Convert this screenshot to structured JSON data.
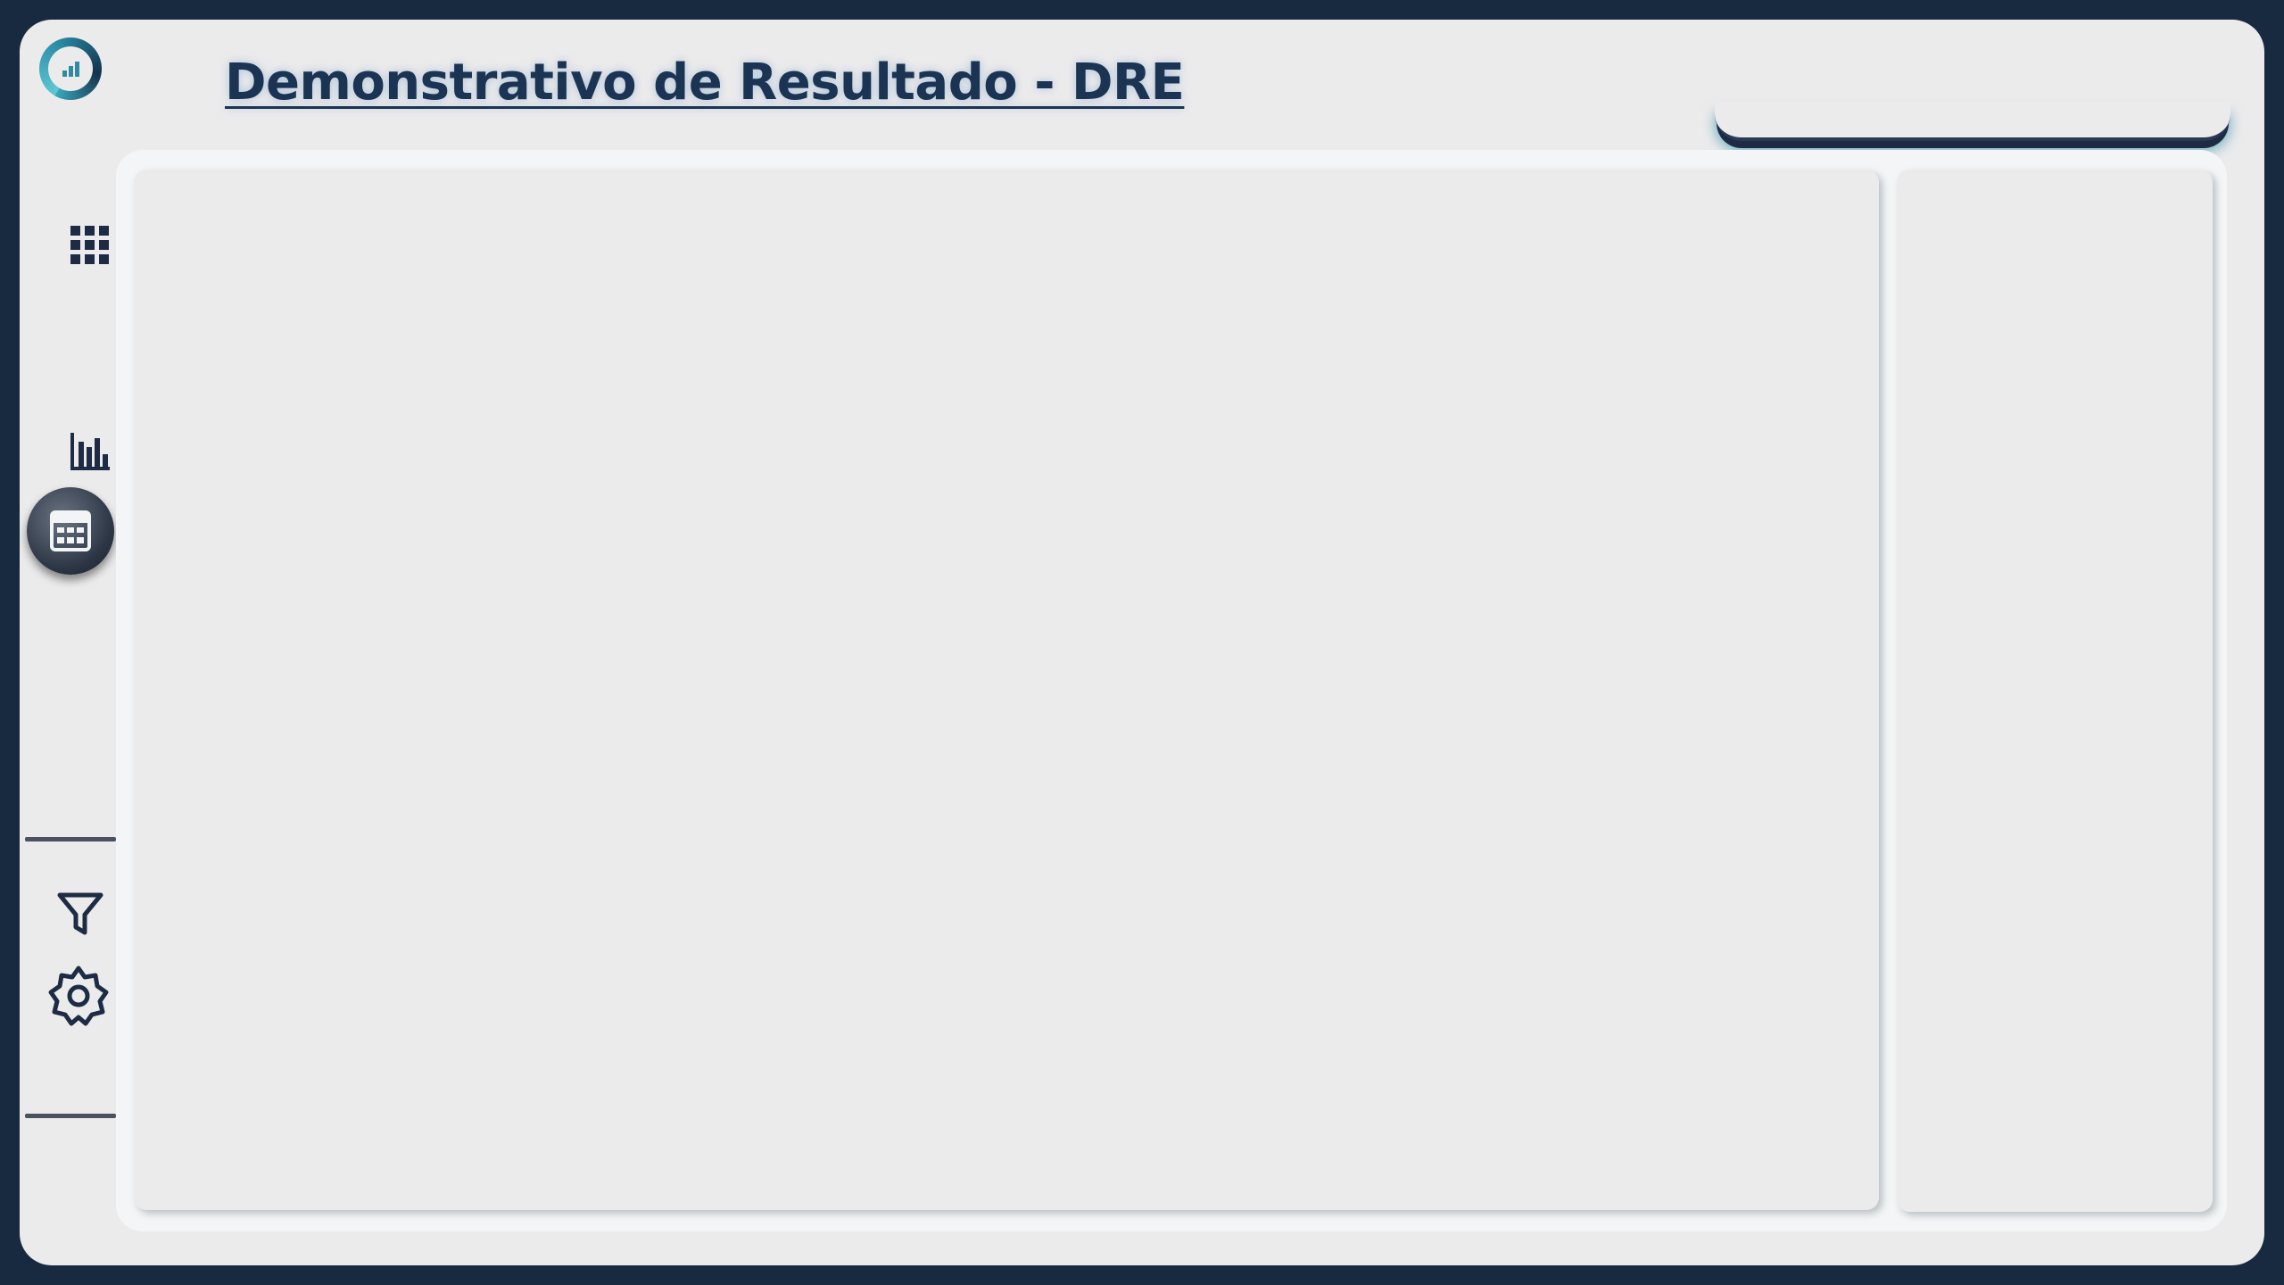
{
  "header": {
    "title": "Demonstrativo de Resultado - DRE"
  },
  "sidebar": {
    "items": [
      {
        "icon": "grid-icon"
      },
      {
        "icon": "bar-chart-icon"
      },
      {
        "icon": "calculator-icon",
        "active": true
      },
      {
        "icon": "filter-icon"
      },
      {
        "icon": "gear-icon"
      }
    ]
  },
  "colors": {
    "background": "#172a40",
    "surface": "#ecebec",
    "accent": "#2f8aa3",
    "title": "#1b3453"
  }
}
